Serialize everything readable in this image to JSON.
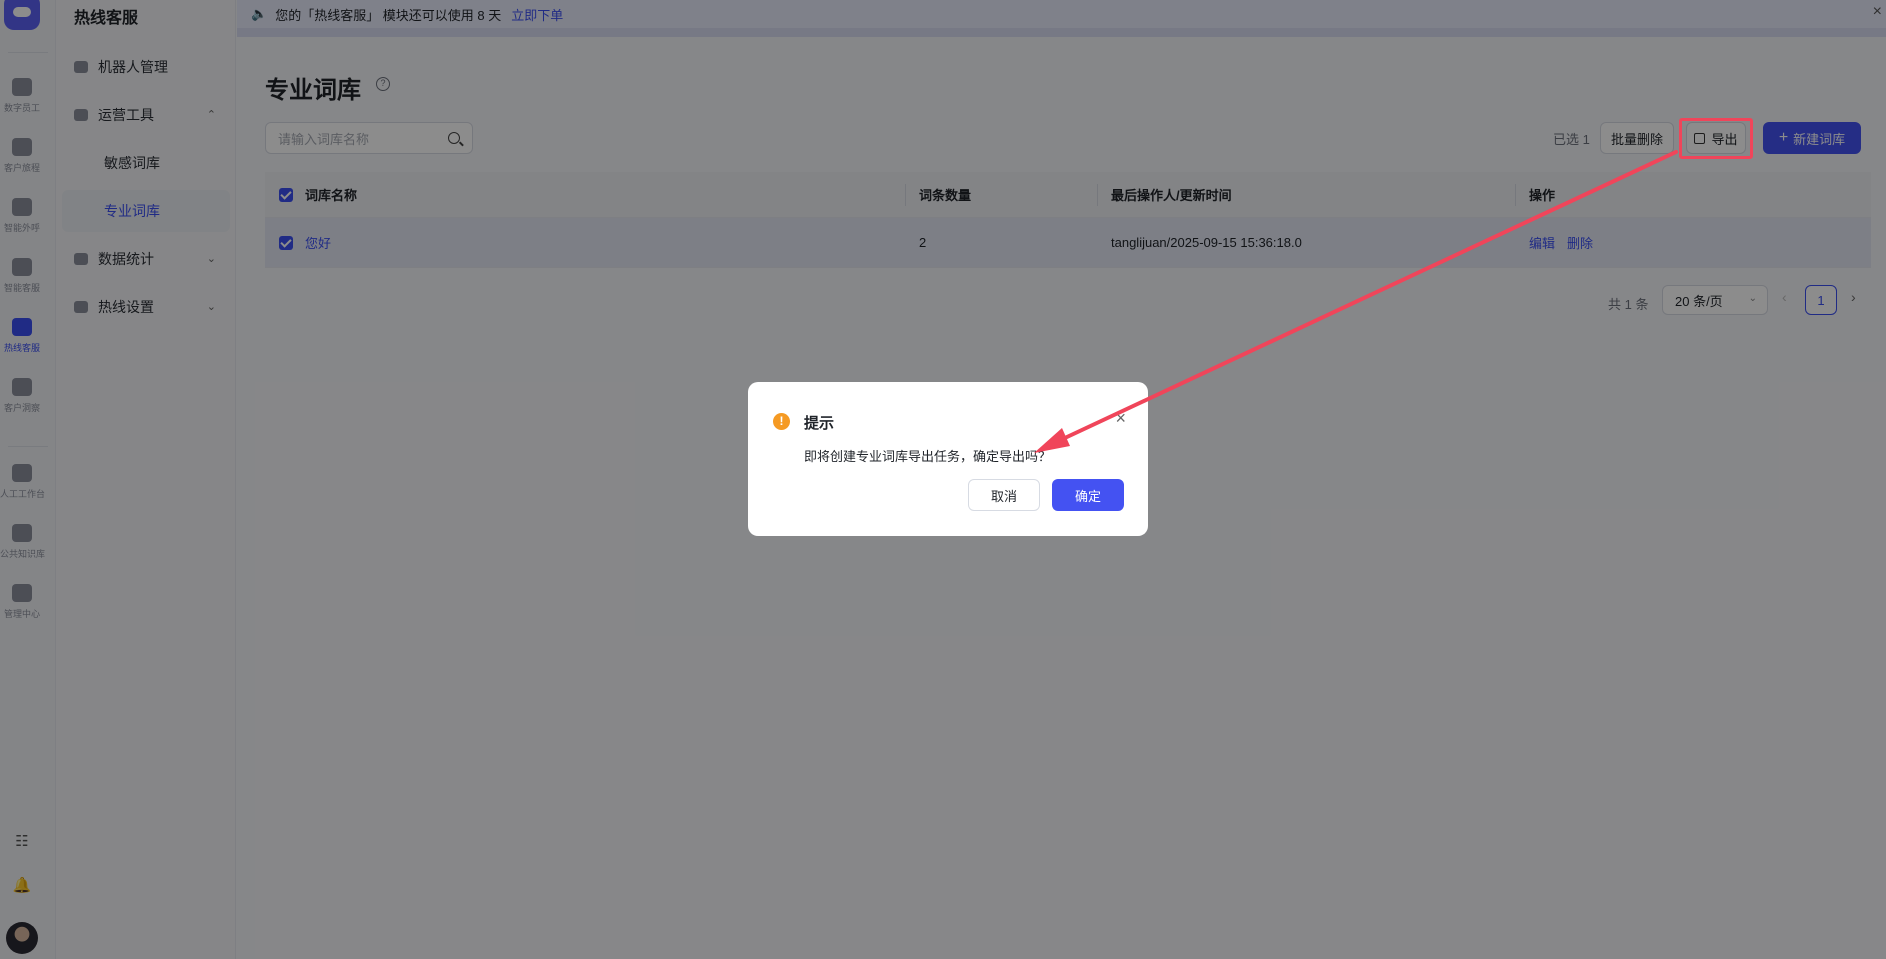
{
  "rail": {
    "items": [
      {
        "label": "数字员工",
        "icon": "person-card-icon"
      },
      {
        "label": "客户旅程",
        "icon": "map-pin-icon"
      },
      {
        "label": "智能外呼",
        "icon": "agent-call-icon"
      },
      {
        "label": "智能客服",
        "icon": "robot-chat-icon"
      },
      {
        "label": "热线客服",
        "icon": "phone-icon"
      },
      {
        "label": "客户洞察",
        "icon": "insight-chart-icon"
      },
      {
        "label": "人工工作台",
        "icon": "workbench-icon"
      },
      {
        "label": "公共知识库",
        "icon": "book-icon"
      },
      {
        "label": "管理中心",
        "icon": "monitor-icon"
      }
    ]
  },
  "sidebar": {
    "app_title": "热线客服",
    "items": [
      {
        "label": "机器人管理"
      },
      {
        "label": "运营工具"
      },
      {
        "label": "敏感词库"
      },
      {
        "label": "专业词库"
      },
      {
        "label": "数据统计"
      },
      {
        "label": "热线设置"
      }
    ]
  },
  "notice": {
    "text": "您的「热线客服」 模块还可以使用 8 天",
    "link": "立即下单"
  },
  "page": {
    "title": "专业词库",
    "search_placeholder": "请输入词库名称",
    "selected_count": "已选 1",
    "batch_delete": "批量删除",
    "export": "导出",
    "new_library": "新建词库"
  },
  "table": {
    "headers": [
      "词库名称",
      "词条数量",
      "最后操作人/更新时间",
      "操作"
    ],
    "rows": [
      {
        "name": "您好",
        "count": "2",
        "updated": "tanglijuan/2025-09-15 15:36:18.0",
        "edit": "编辑",
        "delete": "删除"
      }
    ]
  },
  "pagination": {
    "total": "共 1 条",
    "page_size": "20 条/页",
    "current_page": "1"
  },
  "dialog": {
    "title": "提示",
    "message": "即将创建专业词库导出任务，确定导出吗？",
    "cancel": "取消",
    "confirm": "确定"
  },
  "colors": {
    "primary": "#4452f2",
    "highlight": "#f0455a",
    "warning": "#f59a23"
  }
}
